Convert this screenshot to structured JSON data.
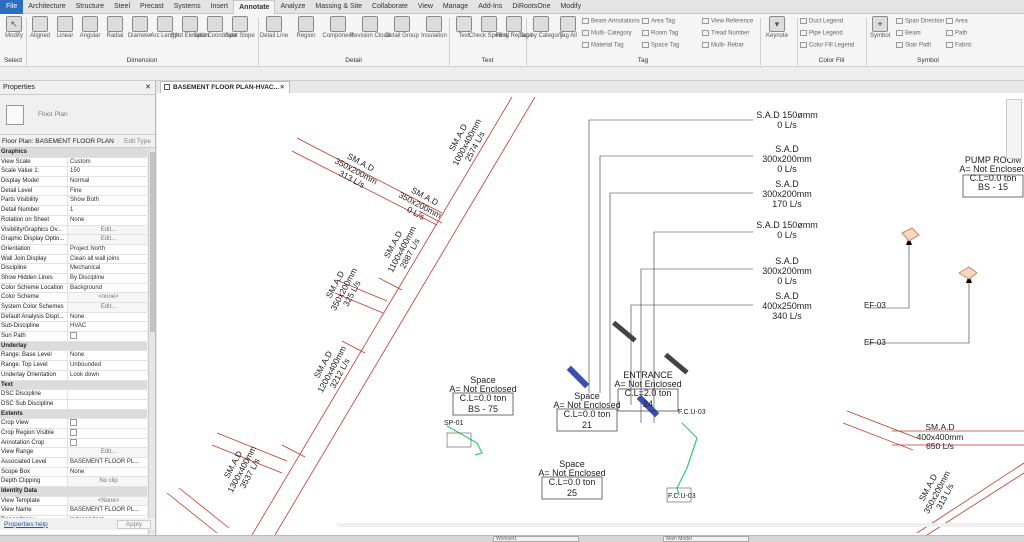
{
  "ribbon_tabs": [
    "File",
    "Architecture",
    "Structure",
    "Steel",
    "Precast",
    "Systems",
    "Insert",
    "Annotate",
    "Analyze",
    "Massing & Site",
    "Collaborate",
    "View",
    "Manage",
    "Add-Ins",
    "DiRootsOne",
    "Modify"
  ],
  "active_tab": "Annotate",
  "ribbon": {
    "modify": "Modify",
    "dimension_tools": [
      "Aligned",
      "Linear",
      "Angular",
      "Radial",
      "Diameter",
      "Arc Length",
      "Spot Elevation",
      "Spot Coordinate",
      "Spot Slope"
    ],
    "detail_tools": [
      "Detail Line",
      "Region",
      "Component",
      "Revision Cloud",
      "Detail Group",
      "Insulation"
    ],
    "text_tools": [
      "Text",
      "Check Spelling",
      "Find/ Replace"
    ],
    "tag_tools": [
      "Tag by Category",
      "Tag All"
    ],
    "tag_small": [
      "Beam Annotations",
      "Multi- Category",
      "Material Tag",
      "Area Tag",
      "Room Tag",
      "Space Tag",
      "View Reference",
      "Tread Number",
      "Multi- Rebar"
    ],
    "keynote": "Keynote",
    "color_fill_small": [
      "Duct Legend",
      "Pipe Legend",
      "Color Fill Legend"
    ],
    "symbol": "Symbol",
    "symbol_small": [
      "Span Direction",
      "Beam",
      "Stair Path",
      "Area",
      "Path",
      "Fabric"
    ],
    "groups": {
      "select": "Select",
      "dimension": "Dimension",
      "detail": "Detail",
      "text": "Text",
      "tag": "Tag",
      "color_fill": "Color Fill",
      "symbol": "Symbol"
    }
  },
  "properties": {
    "title": "Properties",
    "type_name": "Floor Plan",
    "instance": "Floor Plan: BASEMENT FLOOR PLAN",
    "edit_type": "Edit Type",
    "help_link": "Properties help",
    "apply": "Apply",
    "rows": [
      {
        "k": "Graphics",
        "cat": true
      },
      {
        "k": "View Scale",
        "v": "Custom"
      },
      {
        "k": "Scale Value   1:",
        "v": "150"
      },
      {
        "k": "Display Model",
        "v": "Normal"
      },
      {
        "k": "Detail Level",
        "v": "Fine"
      },
      {
        "k": "Parts Visibility",
        "v": "Show Both"
      },
      {
        "k": "Detail Number",
        "v": "1"
      },
      {
        "k": "Rotation on Sheet",
        "v": "None"
      },
      {
        "k": "Visibility/Graphics Ov...",
        "v": "Edit...",
        "btn": true
      },
      {
        "k": "Graphic Display Optio...",
        "v": "Edit...",
        "btn": true
      },
      {
        "k": "Orientation",
        "v": "Project North"
      },
      {
        "k": "Wall Join Display",
        "v": "Clean all wall joins"
      },
      {
        "k": "Discipline",
        "v": "Mechanical"
      },
      {
        "k": "Show Hidden Lines",
        "v": "By Discipline"
      },
      {
        "k": "Color Scheme Location",
        "v": "Background"
      },
      {
        "k": "Color Scheme",
        "v": "<none>",
        "btn": true
      },
      {
        "k": "System Color Schemes",
        "v": "Edit...",
        "btn": true
      },
      {
        "k": "Default Analysis Displ...",
        "v": "None"
      },
      {
        "k": "Sub-Discipline",
        "v": "HVAC"
      },
      {
        "k": "Sun Path",
        "v": "",
        "cb": true
      },
      {
        "k": "Underlay",
        "cat": true
      },
      {
        "k": "Range: Base Level",
        "v": "None"
      },
      {
        "k": "Range: Top Level",
        "v": "Unbounded"
      },
      {
        "k": "Underlay Orientation",
        "v": "Look down"
      },
      {
        "k": "Text",
        "cat": true
      },
      {
        "k": "DSC Discipline",
        "v": ""
      },
      {
        "k": "DSC Sub Discipline",
        "v": ""
      },
      {
        "k": "Extents",
        "cat": true
      },
      {
        "k": "Crop View",
        "v": "",
        "cb": true
      },
      {
        "k": "Crop Region Visible",
        "v": "",
        "cb": true
      },
      {
        "k": "Annotation Crop",
        "v": "",
        "cb": true
      },
      {
        "k": "View Range",
        "v": "Edit...",
        "btn": true
      },
      {
        "k": "Associated Level",
        "v": "BASEMENT FLOOR PL..."
      },
      {
        "k": "Scope Box",
        "v": "None"
      },
      {
        "k": "Depth Clipping",
        "v": "No clip",
        "btn": true
      },
      {
        "k": "Identity Data",
        "cat": true
      },
      {
        "k": "View Template",
        "v": "<None>",
        "btn": true
      },
      {
        "k": "View Name",
        "v": "BASEMENT FLOOR PL..."
      },
      {
        "k": "Dependency",
        "v": "Independent"
      }
    ]
  },
  "view_tab": "BASEMENT FLOOR PLAN-HVAC...",
  "drawing": {
    "tags": [
      {
        "lines": [
          "S.A.D 150ømm",
          "0 L/s"
        ]
      },
      {
        "lines": [
          "S.A.D",
          "300x200mm",
          "0 L/s"
        ]
      },
      {
        "lines": [
          "S.A.D",
          "300x200mm",
          "170 L/s"
        ]
      },
      {
        "lines": [
          "S.A.D 150ømm",
          "0 L/s"
        ]
      },
      {
        "lines": [
          "S.A.D",
          "300x200mm",
          "0 L/s"
        ]
      },
      {
        "lines": [
          "S.A.D",
          "400x250mm",
          "340 L/s"
        ]
      }
    ],
    "pump_room": {
      "name": "PUMP ROOM",
      "area": "A= Not Enclosed",
      "cl": "C.L=0.0 ton",
      "num": "BS - 15"
    },
    "ef_labels": [
      "EF-03",
      "EF-03"
    ],
    "spaces": [
      {
        "name": "Space",
        "area": "A= Not Enclosed",
        "cl": "C.L=0.0 ton",
        "num": "BS - 75"
      },
      {
        "name": "Space",
        "area": "A= Not Enclosed",
        "cl": "C.L=0.0 ton",
        "num": "21"
      },
      {
        "name": "ENTRANCE",
        "area": "A= Not Enclosed",
        "cl": "C.L=2.0 ton",
        "num": "24"
      },
      {
        "name": "Space",
        "area": "A= Not Enclosed",
        "cl": "C.L=0.0 ton",
        "num": "25"
      }
    ],
    "duct_labels": [
      {
        "lines": [
          "SM.A.D",
          "1000x400mm",
          "2574 L/s"
        ]
      },
      {
        "lines": [
          "SM.A.D",
          "350x200mm",
          "313 L/s"
        ]
      },
      {
        "lines": [
          "SM.A.D",
          "350x200mm",
          "0 L/s"
        ]
      },
      {
        "lines": [
          "SM.A.D",
          "1100x400mm",
          "2887 L/s"
        ]
      },
      {
        "lines": [
          "SM.A.D",
          "350x200mm",
          "325 L/s"
        ]
      },
      {
        "lines": [
          "SM.A.D",
          "1200x400mm",
          "3212 L/s"
        ]
      },
      {
        "lines": [
          "SM.A.D",
          "1300x400mm",
          "3537 L/s"
        ]
      },
      {
        "lines": [
          "SM.A.D",
          "400x400mm",
          "650 L/s"
        ]
      },
      {
        "lines": [
          "SM.A.D",
          "350x200mm",
          "313 L/s"
        ]
      }
    ],
    "small_tags": [
      "F.C.U-03",
      "SP-01",
      "F.C.U-03"
    ]
  },
  "status": {
    "workset": "Workset1",
    "model": "Main Model"
  }
}
